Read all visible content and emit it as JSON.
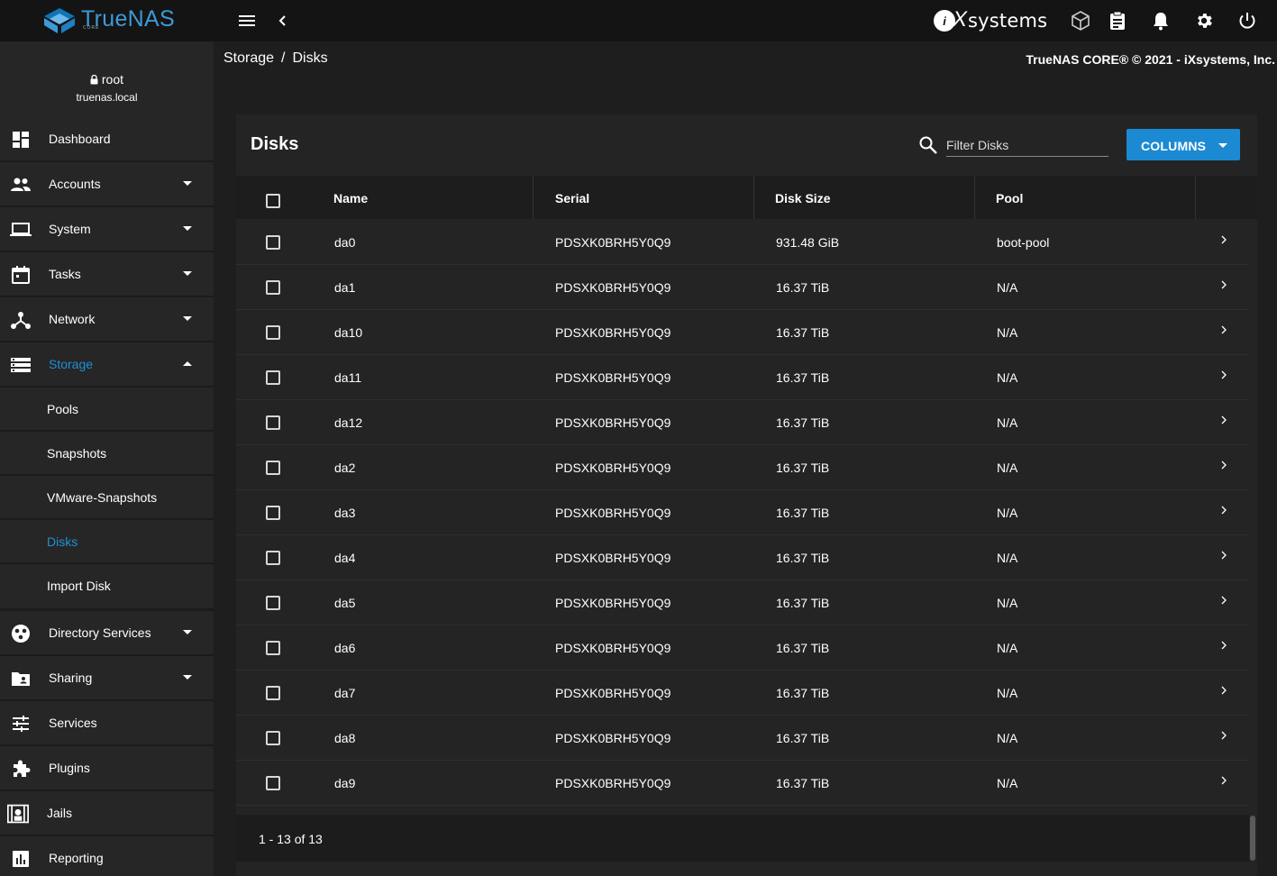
{
  "app": {
    "logo_text": "TrueNAS",
    "logo_sub": "CORE",
    "vendor_badge": "i",
    "vendor_x": "X",
    "vendor_text": "systems"
  },
  "user": {
    "name": "root",
    "host": "truenas.local"
  },
  "sidebar": {
    "items": [
      {
        "label": "Dashboard",
        "icon": "dashboard-icon"
      },
      {
        "label": "Accounts",
        "icon": "accounts-icon"
      },
      {
        "label": "System",
        "icon": "laptop-icon"
      },
      {
        "label": "Tasks",
        "icon": "calendar-icon"
      },
      {
        "label": "Network",
        "icon": "network-icon"
      },
      {
        "label": "Storage",
        "icon": "storage-icon"
      }
    ],
    "storage_sub": [
      "Pools",
      "Snapshots",
      "VMware-Snapshots",
      "Disks",
      "Import Disk"
    ],
    "items_lower": [
      {
        "label": "Directory Services",
        "icon": "directory-services-icon"
      },
      {
        "label": "Sharing",
        "icon": "sharing-icon"
      },
      {
        "label": "Services",
        "icon": "services-icon"
      },
      {
        "label": "Plugins",
        "icon": "puzzle-icon"
      },
      {
        "label": "Jails",
        "icon": "jail-icon"
      },
      {
        "label": "Reporting",
        "icon": "reporting-icon"
      }
    ]
  },
  "breadcrumb": {
    "parent": "Storage",
    "sep": "/",
    "current": "Disks"
  },
  "copyright": "TrueNAS CORE® © 2021 - iXsystems, Inc.",
  "card": {
    "title": "Disks",
    "filter_placeholder": "Filter Disks",
    "columns_label": "COLUMNS"
  },
  "table": {
    "headers": [
      "Name",
      "Serial",
      "Disk Size",
      "Pool"
    ],
    "rows": [
      {
        "name": "da0",
        "serial": "PDSXK0BRH5Y0Q9",
        "size": "931.48 GiB",
        "pool": "boot-pool"
      },
      {
        "name": "da1",
        "serial": "PDSXK0BRH5Y0Q9",
        "size": "16.37 TiB",
        "pool": "N/A"
      },
      {
        "name": "da10",
        "serial": "PDSXK0BRH5Y0Q9",
        "size": "16.37 TiB",
        "pool": "N/A"
      },
      {
        "name": "da11",
        "serial": "PDSXK0BRH5Y0Q9",
        "size": "16.37 TiB",
        "pool": "N/A"
      },
      {
        "name": "da12",
        "serial": "PDSXK0BRH5Y0Q9",
        "size": "16.37 TiB",
        "pool": "N/A"
      },
      {
        "name": "da2",
        "serial": "PDSXK0BRH5Y0Q9",
        "size": "16.37 TiB",
        "pool": "N/A"
      },
      {
        "name": "da3",
        "serial": "PDSXK0BRH5Y0Q9",
        "size": "16.37 TiB",
        "pool": "N/A"
      },
      {
        "name": "da4",
        "serial": "PDSXK0BRH5Y0Q9",
        "size": "16.37 TiB",
        "pool": "N/A"
      },
      {
        "name": "da5",
        "serial": "PDSXK0BRH5Y0Q9",
        "size": "16.37 TiB",
        "pool": "N/A"
      },
      {
        "name": "da6",
        "serial": "PDSXK0BRH5Y0Q9",
        "size": "16.37 TiB",
        "pool": "N/A"
      },
      {
        "name": "da7",
        "serial": "PDSXK0BRH5Y0Q9",
        "size": "16.37 TiB",
        "pool": "N/A"
      },
      {
        "name": "da8",
        "serial": "PDSXK0BRH5Y0Q9",
        "size": "16.37 TiB",
        "pool": "N/A"
      },
      {
        "name": "da9",
        "serial": "PDSXK0BRH5Y0Q9",
        "size": "16.37 TiB",
        "pool": "N/A"
      }
    ],
    "pagination": "1 - 13 of 13"
  },
  "colors": {
    "accent": "#1b8ad3",
    "active_text": "#1e90d6",
    "topbar": "#141414",
    "sidebar": "#262626",
    "card": "#242424"
  }
}
